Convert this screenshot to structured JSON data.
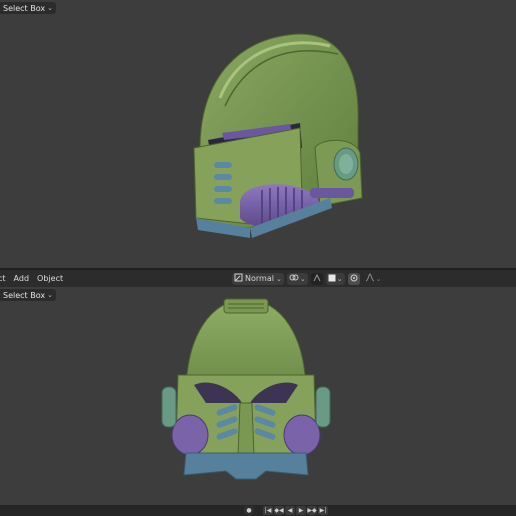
{
  "top_viewport": {
    "select_box_label": "Select Box",
    "object_name": "3D helmet model"
  },
  "header_menu": {
    "select_label": "ct",
    "add_label": "Add",
    "object_label": "Object",
    "orientation_value": "Normal"
  },
  "bottom_viewport": {
    "select_box_label": "Select Box",
    "object_name": "3D helmet model"
  },
  "icons": [
    "orientation-icon",
    "pivot-icon",
    "snap-icon",
    "proportional-icon",
    "falloff-icon",
    "record-icon",
    "jump-start-icon",
    "keyframe-prev-icon",
    "play-reverse-icon",
    "play-icon",
    "keyframe-next-icon",
    "jump-end-icon"
  ],
  "colors": {
    "helmet_green": "#7d9a55",
    "helmet_purple": "#7a63a8",
    "helmet_blue": "#56809c",
    "viewport_bg": "#3d3d3d"
  }
}
